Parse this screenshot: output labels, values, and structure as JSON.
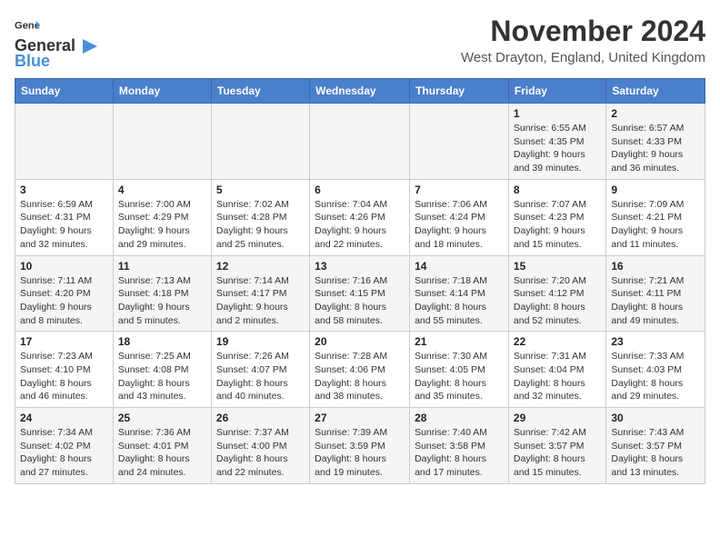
{
  "logo": {
    "line1": "General",
    "line2": "Blue"
  },
  "title": "November 2024",
  "location": "West Drayton, England, United Kingdom",
  "weekdays": [
    "Sunday",
    "Monday",
    "Tuesday",
    "Wednesday",
    "Thursday",
    "Friday",
    "Saturday"
  ],
  "weeks": [
    [
      {
        "day": "",
        "info": ""
      },
      {
        "day": "",
        "info": ""
      },
      {
        "day": "",
        "info": ""
      },
      {
        "day": "",
        "info": ""
      },
      {
        "day": "",
        "info": ""
      },
      {
        "day": "1",
        "info": "Sunrise: 6:55 AM\nSunset: 4:35 PM\nDaylight: 9 hours\nand 39 minutes."
      },
      {
        "day": "2",
        "info": "Sunrise: 6:57 AM\nSunset: 4:33 PM\nDaylight: 9 hours\nand 36 minutes."
      }
    ],
    [
      {
        "day": "3",
        "info": "Sunrise: 6:59 AM\nSunset: 4:31 PM\nDaylight: 9 hours\nand 32 minutes."
      },
      {
        "day": "4",
        "info": "Sunrise: 7:00 AM\nSunset: 4:29 PM\nDaylight: 9 hours\nand 29 minutes."
      },
      {
        "day": "5",
        "info": "Sunrise: 7:02 AM\nSunset: 4:28 PM\nDaylight: 9 hours\nand 25 minutes."
      },
      {
        "day": "6",
        "info": "Sunrise: 7:04 AM\nSunset: 4:26 PM\nDaylight: 9 hours\nand 22 minutes."
      },
      {
        "day": "7",
        "info": "Sunrise: 7:06 AM\nSunset: 4:24 PM\nDaylight: 9 hours\nand 18 minutes."
      },
      {
        "day": "8",
        "info": "Sunrise: 7:07 AM\nSunset: 4:23 PM\nDaylight: 9 hours\nand 15 minutes."
      },
      {
        "day": "9",
        "info": "Sunrise: 7:09 AM\nSunset: 4:21 PM\nDaylight: 9 hours\nand 11 minutes."
      }
    ],
    [
      {
        "day": "10",
        "info": "Sunrise: 7:11 AM\nSunset: 4:20 PM\nDaylight: 9 hours\nand 8 minutes."
      },
      {
        "day": "11",
        "info": "Sunrise: 7:13 AM\nSunset: 4:18 PM\nDaylight: 9 hours\nand 5 minutes."
      },
      {
        "day": "12",
        "info": "Sunrise: 7:14 AM\nSunset: 4:17 PM\nDaylight: 9 hours\nand 2 minutes."
      },
      {
        "day": "13",
        "info": "Sunrise: 7:16 AM\nSunset: 4:15 PM\nDaylight: 8 hours\nand 58 minutes."
      },
      {
        "day": "14",
        "info": "Sunrise: 7:18 AM\nSunset: 4:14 PM\nDaylight: 8 hours\nand 55 minutes."
      },
      {
        "day": "15",
        "info": "Sunrise: 7:20 AM\nSunset: 4:12 PM\nDaylight: 8 hours\nand 52 minutes."
      },
      {
        "day": "16",
        "info": "Sunrise: 7:21 AM\nSunset: 4:11 PM\nDaylight: 8 hours\nand 49 minutes."
      }
    ],
    [
      {
        "day": "17",
        "info": "Sunrise: 7:23 AM\nSunset: 4:10 PM\nDaylight: 8 hours\nand 46 minutes."
      },
      {
        "day": "18",
        "info": "Sunrise: 7:25 AM\nSunset: 4:08 PM\nDaylight: 8 hours\nand 43 minutes."
      },
      {
        "day": "19",
        "info": "Sunrise: 7:26 AM\nSunset: 4:07 PM\nDaylight: 8 hours\nand 40 minutes."
      },
      {
        "day": "20",
        "info": "Sunrise: 7:28 AM\nSunset: 4:06 PM\nDaylight: 8 hours\nand 38 minutes."
      },
      {
        "day": "21",
        "info": "Sunrise: 7:30 AM\nSunset: 4:05 PM\nDaylight: 8 hours\nand 35 minutes."
      },
      {
        "day": "22",
        "info": "Sunrise: 7:31 AM\nSunset: 4:04 PM\nDaylight: 8 hours\nand 32 minutes."
      },
      {
        "day": "23",
        "info": "Sunrise: 7:33 AM\nSunset: 4:03 PM\nDaylight: 8 hours\nand 29 minutes."
      }
    ],
    [
      {
        "day": "24",
        "info": "Sunrise: 7:34 AM\nSunset: 4:02 PM\nDaylight: 8 hours\nand 27 minutes."
      },
      {
        "day": "25",
        "info": "Sunrise: 7:36 AM\nSunset: 4:01 PM\nDaylight: 8 hours\nand 24 minutes."
      },
      {
        "day": "26",
        "info": "Sunrise: 7:37 AM\nSunset: 4:00 PM\nDaylight: 8 hours\nand 22 minutes."
      },
      {
        "day": "27",
        "info": "Sunrise: 7:39 AM\nSunset: 3:59 PM\nDaylight: 8 hours\nand 19 minutes."
      },
      {
        "day": "28",
        "info": "Sunrise: 7:40 AM\nSunset: 3:58 PM\nDaylight: 8 hours\nand 17 minutes."
      },
      {
        "day": "29",
        "info": "Sunrise: 7:42 AM\nSunset: 3:57 PM\nDaylight: 8 hours\nand 15 minutes."
      },
      {
        "day": "30",
        "info": "Sunrise: 7:43 AM\nSunset: 3:57 PM\nDaylight: 8 hours\nand 13 minutes."
      }
    ]
  ]
}
